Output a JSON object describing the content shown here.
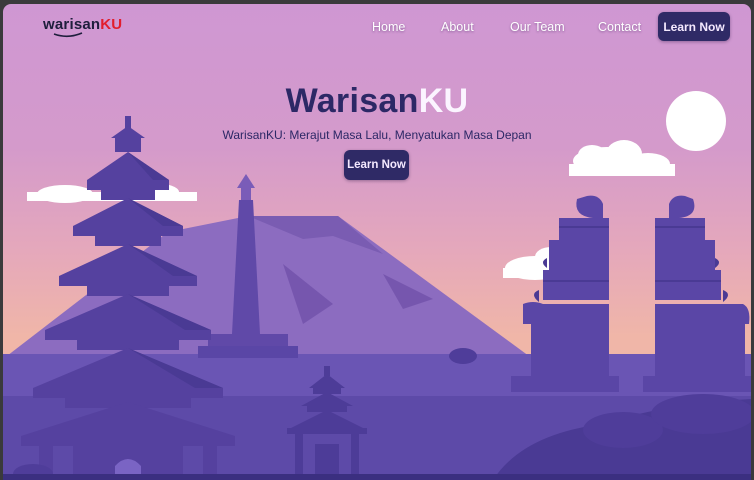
{
  "brand": {
    "name_part1": "warisan",
    "name_part2": "KU"
  },
  "nav": {
    "links": [
      "Home",
      "About",
      "Our Team",
      "Contact"
    ],
    "cta_label": "Learn Now"
  },
  "hero": {
    "title_part1": "Warisan",
    "title_part2": "KU",
    "subtitle": "WarisanKU: Merajut Masa Lalu, Menyatukan Masa Depan",
    "cta_label": "Learn Now"
  },
  "colors": {
    "sky_top": "#cf97d3",
    "sky_bottom": "#f0b6a8",
    "button": "#2f2a66",
    "silhouette": "#5a46a6",
    "mountain": "#8c6cc0",
    "brand_red": "#e21d2c"
  },
  "scene_elements": [
    "pagoda-temple-icon",
    "monas-monument-icon",
    "mountain-icon",
    "split-gate-icon",
    "sun-icon",
    "cloud-icon"
  ]
}
